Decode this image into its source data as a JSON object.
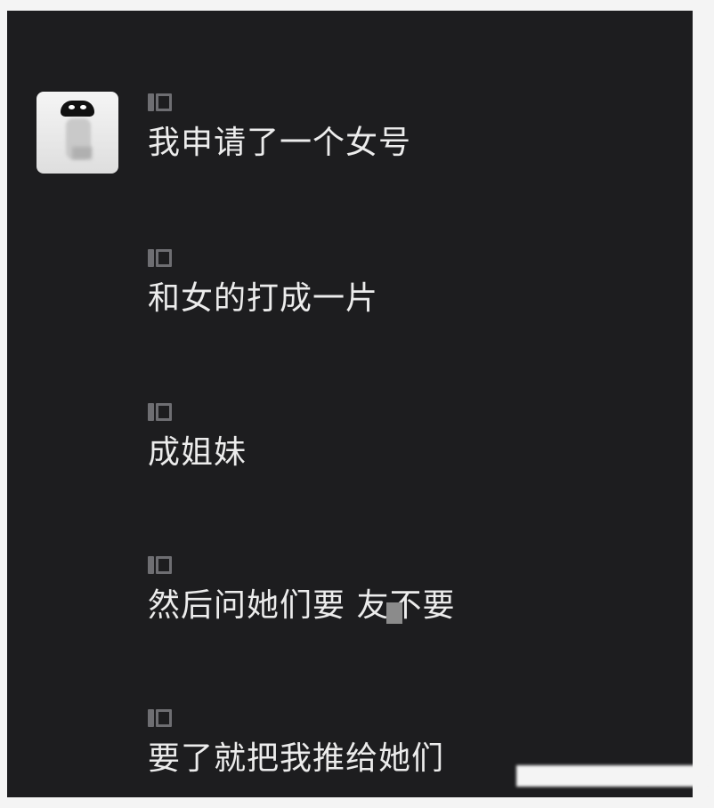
{
  "messages": [
    {
      "text": "我申请了一个女号"
    },
    {
      "text": "和女的打成一片"
    },
    {
      "text": "成姐妹"
    },
    {
      "text": "然后问她们要  友不要"
    },
    {
      "text": "要了就把我推给她们"
    }
  ],
  "icons": {
    "avatar": "avatar",
    "sender_marker": "name-placeholder-icon"
  }
}
